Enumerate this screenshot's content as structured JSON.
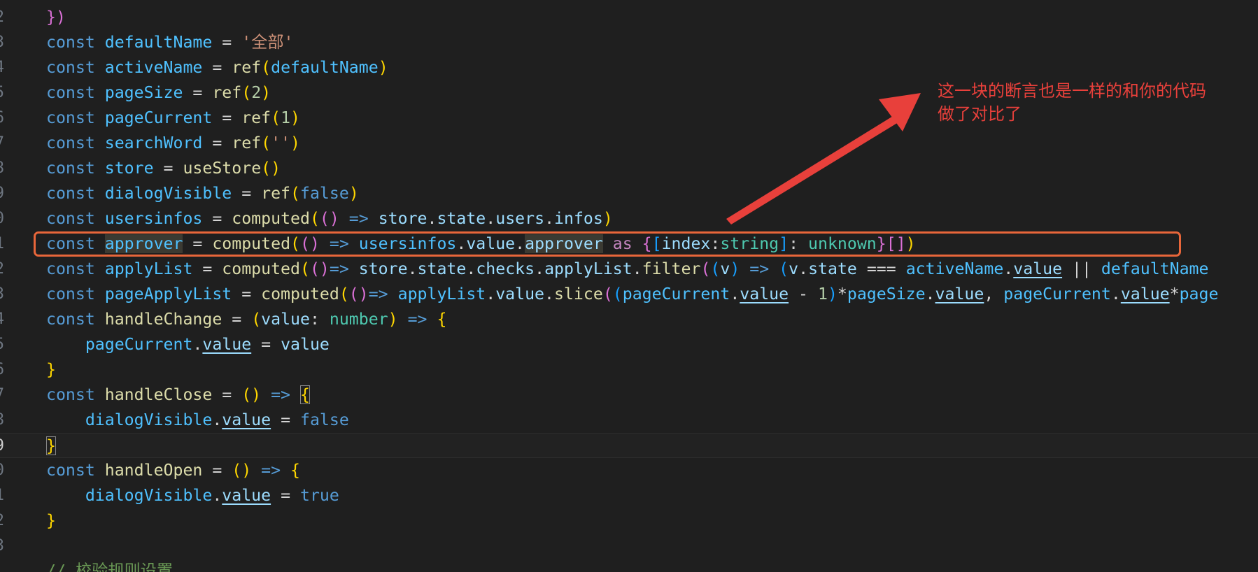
{
  "editor": {
    "lines": [
      {
        "num": "2",
        "tokens": [
          [
            "})",
            "p2"
          ]
        ]
      },
      {
        "num": "3",
        "tokens": [
          [
            "const ",
            "kw"
          ],
          [
            "defaultName",
            "const"
          ],
          [
            " = ",
            "op"
          ],
          [
            "'全部'",
            "str"
          ]
        ]
      },
      {
        "num": "4",
        "tokens": [
          [
            "const ",
            "kw"
          ],
          [
            "activeName",
            "const"
          ],
          [
            " = ",
            "op"
          ],
          [
            "ref",
            "fn"
          ],
          [
            "(",
            "p1"
          ],
          [
            "defaultName",
            "const"
          ],
          [
            ")",
            "p1"
          ]
        ]
      },
      {
        "num": "5",
        "tokens": [
          [
            "const ",
            "kw"
          ],
          [
            "pageSize",
            "const"
          ],
          [
            " = ",
            "op"
          ],
          [
            "ref",
            "fn"
          ],
          [
            "(",
            "p1"
          ],
          [
            "2",
            "num"
          ],
          [
            ")",
            "p1"
          ]
        ]
      },
      {
        "num": "6",
        "tokens": [
          [
            "const ",
            "kw"
          ],
          [
            "pageCurrent",
            "const"
          ],
          [
            " = ",
            "op"
          ],
          [
            "ref",
            "fn"
          ],
          [
            "(",
            "p1"
          ],
          [
            "1",
            "num"
          ],
          [
            ")",
            "p1"
          ]
        ]
      },
      {
        "num": "7",
        "tokens": [
          [
            "const ",
            "kw"
          ],
          [
            "searchWord",
            "const"
          ],
          [
            " = ",
            "op"
          ],
          [
            "ref",
            "fn"
          ],
          [
            "(",
            "p1"
          ],
          [
            "''",
            "str"
          ],
          [
            ")",
            "p1"
          ]
        ]
      },
      {
        "num": "8",
        "tokens": [
          [
            "const ",
            "kw"
          ],
          [
            "store",
            "const"
          ],
          [
            " = ",
            "op"
          ],
          [
            "useStore",
            "fn"
          ],
          [
            "()",
            "p1"
          ]
        ]
      },
      {
        "num": "9",
        "tokens": [
          [
            "const ",
            "kw"
          ],
          [
            "dialogVisible",
            "const"
          ],
          [
            " = ",
            "op"
          ],
          [
            "ref",
            "fn"
          ],
          [
            "(",
            "p1"
          ],
          [
            "false",
            "kw"
          ],
          [
            ")",
            "p1"
          ]
        ]
      },
      {
        "num": "0",
        "tokens": [
          [
            "const ",
            "kw"
          ],
          [
            "usersinfos",
            "const"
          ],
          [
            " = ",
            "op"
          ],
          [
            "computed",
            "fn"
          ],
          [
            "(",
            "p1"
          ],
          [
            "()",
            "p2"
          ],
          [
            " => ",
            "kw"
          ],
          [
            "store",
            "var"
          ],
          [
            ".",
            "op"
          ],
          [
            "state",
            "var"
          ],
          [
            ".",
            "op"
          ],
          [
            "users",
            "var"
          ],
          [
            ".",
            "op"
          ],
          [
            "infos",
            "var"
          ],
          [
            ")",
            "p1"
          ]
        ]
      },
      {
        "num": "1",
        "tokens": [
          [
            "const ",
            "kw"
          ],
          [
            "approver",
            "const hl"
          ],
          [
            " = ",
            "op"
          ],
          [
            "computed",
            "fn"
          ],
          [
            "(",
            "p1"
          ],
          [
            "()",
            "p2"
          ],
          [
            " => ",
            "kw"
          ],
          [
            "usersinfos",
            "const"
          ],
          [
            ".",
            "op"
          ],
          [
            "value",
            "var"
          ],
          [
            ".",
            "op"
          ],
          [
            "approver",
            "var hl"
          ],
          [
            " as ",
            "purple"
          ],
          [
            "{",
            "p2"
          ],
          [
            "[",
            "p3"
          ],
          [
            "index",
            "var"
          ],
          [
            ":",
            "op"
          ],
          [
            "string",
            "type"
          ],
          [
            "]",
            "p3"
          ],
          [
            ": ",
            "op"
          ],
          [
            "unknown",
            "type"
          ],
          [
            "}",
            "p2"
          ],
          [
            "[]",
            "p2"
          ],
          [
            ")",
            "p1"
          ]
        ]
      },
      {
        "num": "2",
        "tokens": [
          [
            "const ",
            "kw"
          ],
          [
            "applyList",
            "const"
          ],
          [
            " = ",
            "op"
          ],
          [
            "computed",
            "fn"
          ],
          [
            "(",
            "p1"
          ],
          [
            "()",
            "p2"
          ],
          [
            "=> ",
            "kw"
          ],
          [
            "store",
            "var"
          ],
          [
            ".",
            "op"
          ],
          [
            "state",
            "var"
          ],
          [
            ".",
            "op"
          ],
          [
            "checks",
            "var"
          ],
          [
            ".",
            "op"
          ],
          [
            "applyList",
            "var"
          ],
          [
            ".",
            "op"
          ],
          [
            "filter",
            "fn"
          ],
          [
            "(",
            "p2"
          ],
          [
            "(",
            "p3"
          ],
          [
            "v",
            "var"
          ],
          [
            ")",
            "p3"
          ],
          [
            " => ",
            "kw"
          ],
          [
            "(",
            "p3"
          ],
          [
            "v",
            "var"
          ],
          [
            ".",
            "op"
          ],
          [
            "state",
            "var"
          ],
          [
            " === ",
            "op"
          ],
          [
            "activeName",
            "const"
          ],
          [
            ".",
            "op"
          ],
          [
            "value",
            "var ul"
          ],
          [
            " || ",
            "op"
          ],
          [
            "defaultName",
            "const"
          ]
        ]
      },
      {
        "num": "3",
        "tokens": [
          [
            "const ",
            "kw"
          ],
          [
            "pageApplyList",
            "const"
          ],
          [
            " = ",
            "op"
          ],
          [
            "computed",
            "fn"
          ],
          [
            "(",
            "p1"
          ],
          [
            "()",
            "p2"
          ],
          [
            "=> ",
            "kw"
          ],
          [
            "applyList",
            "const"
          ],
          [
            ".",
            "op"
          ],
          [
            "value",
            "var"
          ],
          [
            ".",
            "op"
          ],
          [
            "slice",
            "fn"
          ],
          [
            "(",
            "p2"
          ],
          [
            "(",
            "p3"
          ],
          [
            "pageCurrent",
            "const"
          ],
          [
            ".",
            "op"
          ],
          [
            "value",
            "var ul"
          ],
          [
            " - ",
            "op"
          ],
          [
            "1",
            "num"
          ],
          [
            ")",
            "p3"
          ],
          [
            "*",
            "op"
          ],
          [
            "pageSize",
            "const"
          ],
          [
            ".",
            "op"
          ],
          [
            "value",
            "var ul"
          ],
          [
            ", ",
            "op"
          ],
          [
            "pageCurrent",
            "const"
          ],
          [
            ".",
            "op"
          ],
          [
            "value",
            "var ul"
          ],
          [
            "*",
            "op"
          ],
          [
            "page",
            "const"
          ]
        ]
      },
      {
        "num": "4",
        "tokens": [
          [
            "const ",
            "kw"
          ],
          [
            "handleChange",
            "fn"
          ],
          [
            " = ",
            "op"
          ],
          [
            "(",
            "p1"
          ],
          [
            "value",
            "var"
          ],
          [
            ": ",
            "op"
          ],
          [
            "number",
            "type"
          ],
          [
            ")",
            "p1"
          ],
          [
            " => ",
            "kw"
          ],
          [
            "{",
            "p1"
          ]
        ]
      },
      {
        "num": "5",
        "tokens": [
          [
            "    pageCurrent",
            "const"
          ],
          [
            ".",
            "op"
          ],
          [
            "value",
            "var ul"
          ],
          [
            " = ",
            "op"
          ],
          [
            "value",
            "var"
          ]
        ]
      },
      {
        "num": "6",
        "tokens": [
          [
            "}",
            "p1"
          ]
        ]
      },
      {
        "num": "7",
        "tokens": [
          [
            "const ",
            "kw"
          ],
          [
            "handleClose",
            "fn"
          ],
          [
            " = ",
            "op"
          ],
          [
            "()",
            "p1"
          ],
          [
            " => ",
            "kw"
          ],
          [
            "{",
            "p1 box"
          ]
        ]
      },
      {
        "num": "8",
        "tokens": [
          [
            "    dialogVisible",
            "const"
          ],
          [
            ".",
            "op"
          ],
          [
            "value",
            "var ul"
          ],
          [
            " = ",
            "op"
          ],
          [
            "false",
            "kw"
          ]
        ]
      },
      {
        "num": "9",
        "tokens": [
          [
            "}",
            "p1 box"
          ]
        ]
      },
      {
        "num": "0",
        "tokens": [
          [
            "const ",
            "kw"
          ],
          [
            "handleOpen",
            "fn"
          ],
          [
            " = ",
            "op"
          ],
          [
            "()",
            "p1"
          ],
          [
            " => ",
            "kw"
          ],
          [
            "{",
            "p1"
          ]
        ]
      },
      {
        "num": "1",
        "tokens": [
          [
            "    dialogVisible",
            "const"
          ],
          [
            ".",
            "op"
          ],
          [
            "value",
            "var ul"
          ],
          [
            " = ",
            "op"
          ],
          [
            "true",
            "kw"
          ]
        ]
      },
      {
        "num": "2",
        "tokens": [
          [
            "}",
            "p1"
          ]
        ]
      },
      {
        "num": "3",
        "tokens": []
      },
      {
        "num": "",
        "tokens": [
          [
            "// 校验规则设置",
            "comment"
          ]
        ]
      }
    ]
  },
  "annotation": {
    "line1": "这一块的断言也是一样的和你的代码",
    "line2": "做了对比了",
    "color": "#e8403b"
  },
  "highlight_box_color": "#e8663a"
}
